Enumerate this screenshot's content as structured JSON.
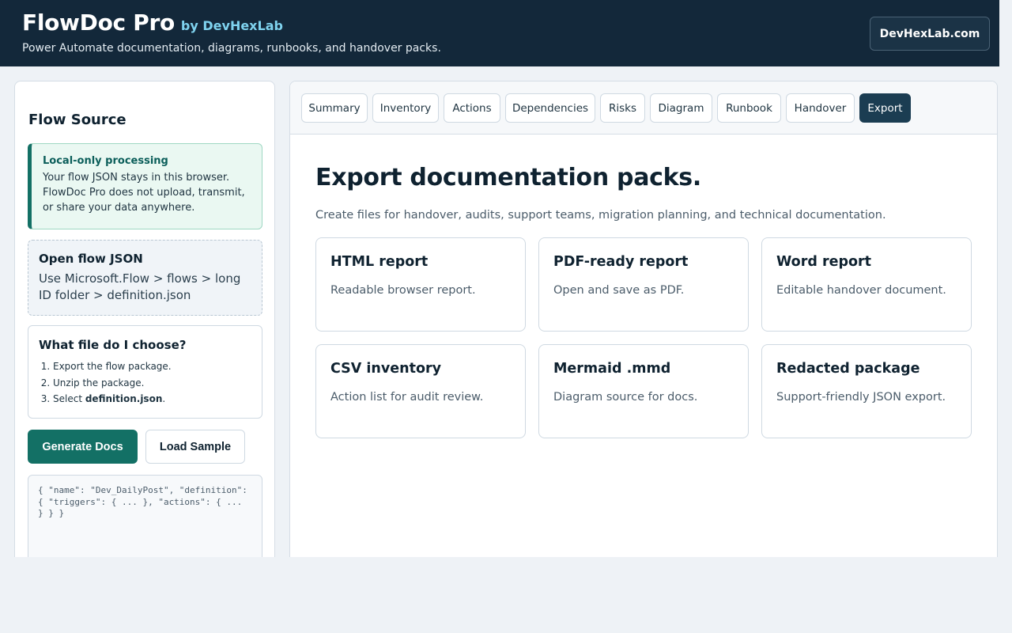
{
  "header": {
    "app_name": "FlowDoc Pro",
    "by_line": "by DevHexLab",
    "tagline": "Power Automate documentation, diagrams, runbooks, and handover packs.",
    "site_button": "DevHexLab.com"
  },
  "sidebar": {
    "title": "Flow Source",
    "local": {
      "title": "Local-only processing",
      "text": "Your flow JSON stays in this browser. FlowDoc Pro does not upload, transmit, or share your data anywhere."
    },
    "open": {
      "title": "Open flow JSON",
      "text": "Use Microsoft.Flow > flows > long ID folder > definition.json"
    },
    "which": {
      "title": "What file do I choose?",
      "steps": [
        "Export the flow package.",
        "Unzip the package.",
        "Select ",
        "definition.json",
        "."
      ]
    },
    "generate_label": "Generate Docs",
    "load_label": "Load Sample",
    "json_preview": "{ \"name\": \"Dev_DailyPost\", \"definition\": { \"triggers\": { ... }, \"actions\": { ... } } }"
  },
  "tabs": [
    {
      "label": "Summary",
      "active": false
    },
    {
      "label": "Inventory",
      "active": false
    },
    {
      "label": "Actions",
      "active": false
    },
    {
      "label": "Dependencies",
      "active": false
    },
    {
      "label": "Risks",
      "active": false
    },
    {
      "label": "Diagram",
      "active": false
    },
    {
      "label": "Runbook",
      "active": false
    },
    {
      "label": "Handover",
      "active": false
    },
    {
      "label": "Export",
      "active": true
    }
  ],
  "main": {
    "title": "Export documentation packs.",
    "subtitle": "Create files for handover, audits, support teams, migration planning, and technical documentation.",
    "cards": [
      {
        "title": "HTML report",
        "text": "Readable browser report."
      },
      {
        "title": "PDF-ready report",
        "text": "Open and save as PDF."
      },
      {
        "title": "Word report",
        "text": "Editable handover document."
      },
      {
        "title": "CSV inventory",
        "text": "Action list for audit review."
      },
      {
        "title": "Mermaid .mmd",
        "text": "Diagram source for docs."
      },
      {
        "title": "Redacted package",
        "text": "Support-friendly JSON export."
      }
    ]
  },
  "colors": {
    "header_bg": "#13283a",
    "accent_teal": "#137065",
    "active_tab": "#1b3d52",
    "by_line": "#7fd3ef"
  }
}
